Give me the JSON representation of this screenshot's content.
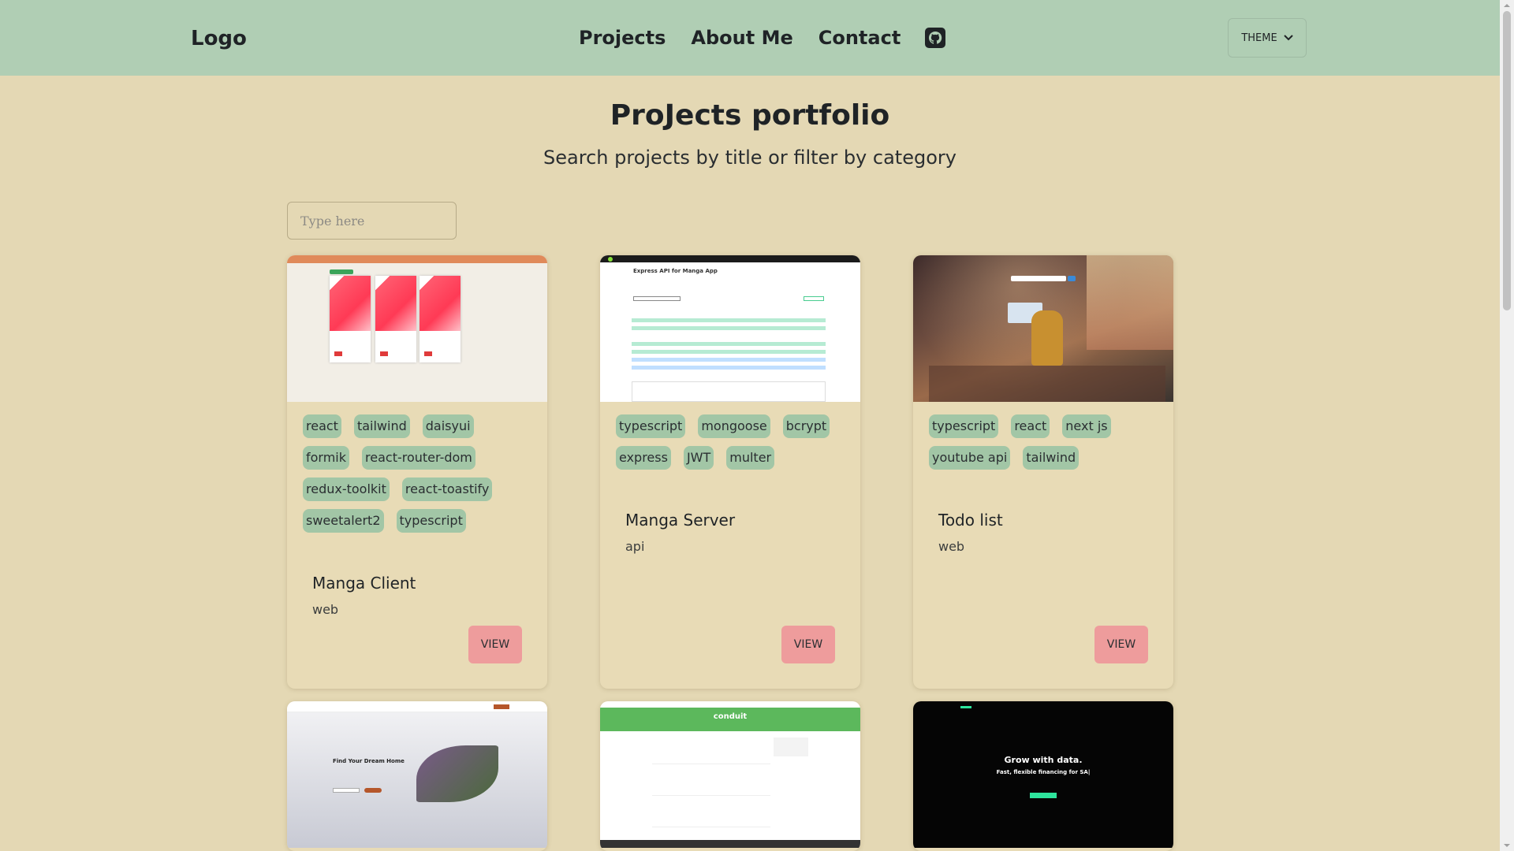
{
  "header": {
    "logo": "Logo",
    "nav": [
      "Projects",
      "About Me",
      "Contact"
    ],
    "github_icon": "github-icon",
    "theme_label": "THEME"
  },
  "main": {
    "title": "ProJects portfolio",
    "subtitle": "Search projects by title or filter by category",
    "search_placeholder": "Type here"
  },
  "projects": [
    {
      "title": "Manga Client",
      "category": "web",
      "tags": [
        "react",
        "tailwind",
        "daisyui",
        "formik",
        "react-router-dom",
        "redux-toolkit",
        "react-toastify",
        "sweetalert2",
        "typescript"
      ],
      "button": "VIEW"
    },
    {
      "title": "Manga Server",
      "category": "api",
      "tags": [
        "typescript",
        "mongoose",
        "bcrypt",
        "express",
        "JWT",
        "multer"
      ],
      "button": "VIEW"
    },
    {
      "title": "Todo list",
      "category": "web",
      "tags": [
        "typescript",
        "react",
        "next js",
        "youtube api",
        "tailwind"
      ],
      "button": "VIEW"
    }
  ],
  "previews": {
    "swagger_title": "Express API for Manga App",
    "dream_home": "Find Your Dream Home",
    "conduit": "conduit",
    "grow_title": "Grow with data.",
    "grow_sub": "Fast, flexible financing for SA|"
  },
  "colors": {
    "navbar": "#b0ceb4",
    "background": "#e4d8b4",
    "tag": "#a2c6a6",
    "button": "#ee9c9c"
  }
}
